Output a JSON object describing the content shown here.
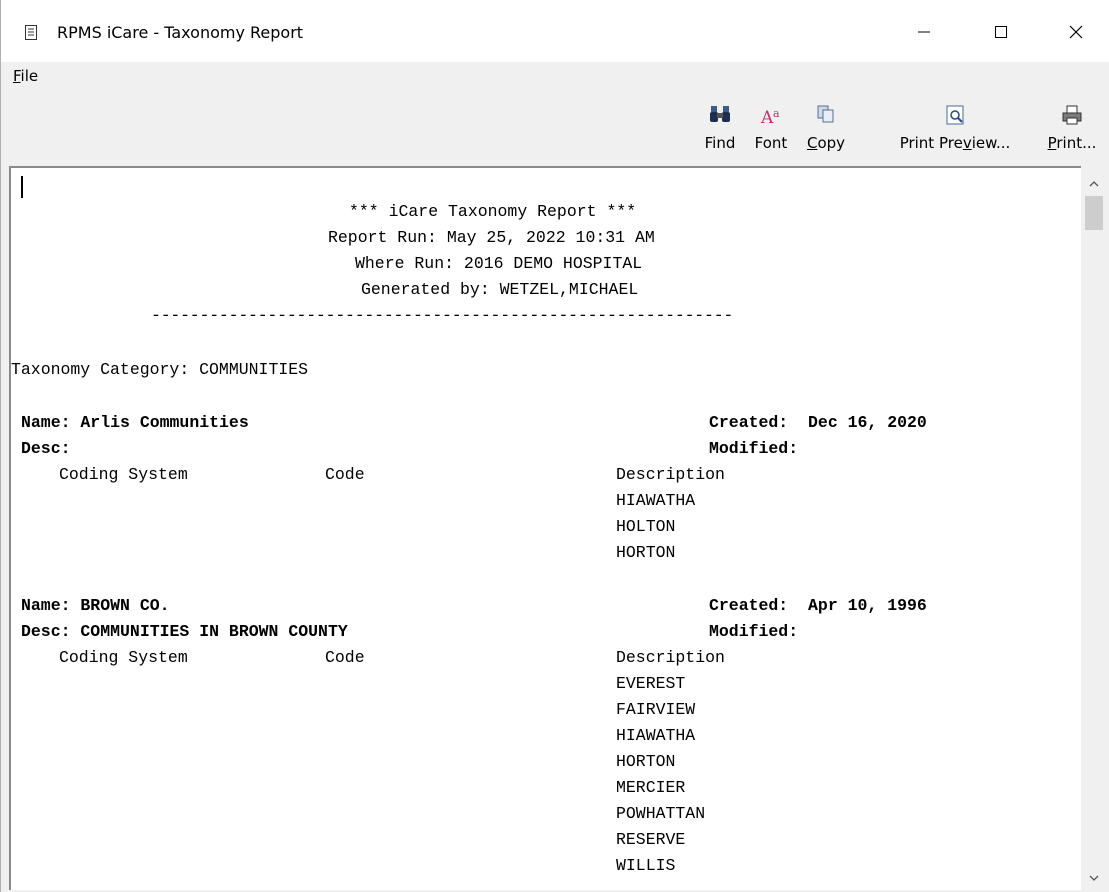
{
  "window": {
    "title": "RPMS iCare - Taxonomy Report",
    "minimize_glyph": "—",
    "maximize_glyph": "☐",
    "close_glyph": "✕"
  },
  "menu": {
    "file": "File"
  },
  "toolbar": {
    "find": "Find",
    "font": "Font",
    "copy": "Copy",
    "print_preview": "Print Preview...",
    "print": "Print..."
  },
  "report": {
    "header_title": "*** iCare Taxonomy Report ***",
    "header_run": "Report Run: May 25, 2022 10:31 AM",
    "header_where": "Where Run: 2016 DEMO HOSPITAL",
    "header_by": "Generated by: WETZEL,MICHAEL",
    "separator": "------------------------------------------------------------",
    "category": "Taxonomy Category: COMMUNITIES",
    "entries": [
      {
        "name_line": "Name: Arlis Communities",
        "created_line": "Created:  Dec 16, 2020",
        "desc_line": "Desc:",
        "modified_line": "Modified:",
        "col_system": "Coding System",
        "col_code": "Code",
        "col_desc": "Description",
        "items": [
          "HIAWATHA",
          "HOLTON",
          "HORTON"
        ]
      },
      {
        "name_line": "Name: BROWN CO.",
        "created_line": "Created:  Apr 10, 1996",
        "desc_line": "Desc: COMMUNITIES IN BROWN COUNTY",
        "modified_line": "Modified:",
        "col_system": "Coding System",
        "col_code": "Code",
        "col_desc": "Description",
        "items": [
          "EVEREST",
          "FAIRVIEW",
          "HIAWATHA",
          "HORTON",
          "MERCIER",
          "POWHATTAN",
          "RESERVE",
          "WILLIS"
        ]
      }
    ]
  }
}
